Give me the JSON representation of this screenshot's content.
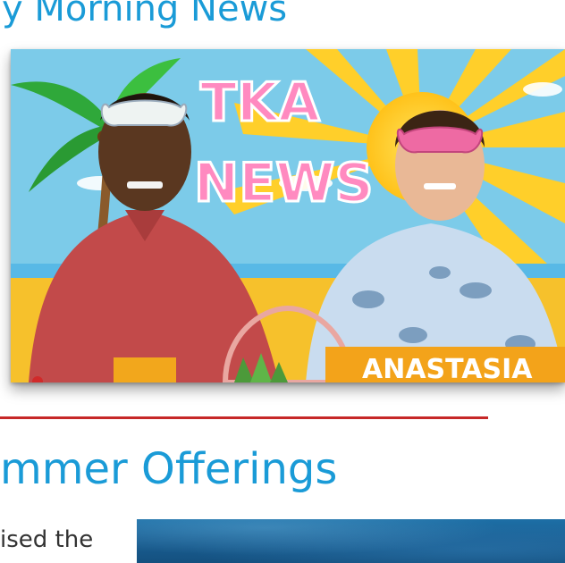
{
  "header": {
    "title": "y Morning News"
  },
  "video": {
    "sign_text": "TKA",
    "sign_text_2": "NEWS",
    "name_plate": "ANASTASIA"
  },
  "section": {
    "title": "mmer Offerings",
    "body_text": "ised the"
  },
  "colors": {
    "heading": "#1a9bd7",
    "divider": "#c62828",
    "body_text": "#333333"
  }
}
